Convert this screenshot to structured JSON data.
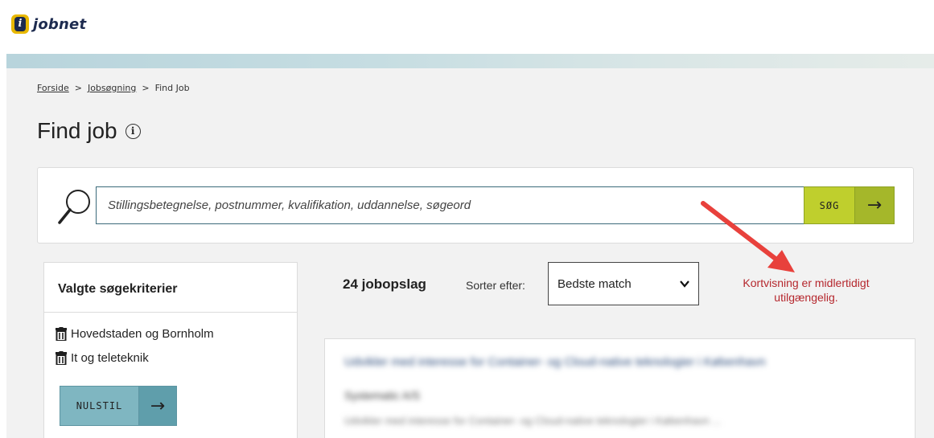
{
  "brand": {
    "name": "jobnet",
    "mark": "i"
  },
  "breadcrumb": {
    "items": [
      "Forside",
      "Jobsøgning",
      "Find Job"
    ],
    "separator": ">"
  },
  "page_title": "Find job",
  "search": {
    "placeholder": "Stillingsbetegnelse, postnummer, kvalifikation, uddannelse, søgeord",
    "button_label": "SØG",
    "button_arrow": "→"
  },
  "sidebar": {
    "heading": "Valgte søgekriterier",
    "criteria": [
      "Hovedstaden og Bornholm",
      "It og teleteknik"
    ],
    "reset_label": "NULSTIL",
    "reset_arrow": "→"
  },
  "results": {
    "count_text": "24 jobopslag",
    "sort_label": "Sorter efter:",
    "sort_value": "Bedste match",
    "notice": "Kortvisning er midlertidigt utilgængelig."
  },
  "job_preview": {
    "title": "Udvikler med interesse for Container- og Cloud-native teknologier i København",
    "company": "Systematic A/S",
    "snippet": "Udvikler med interesse for Container- og Cloud-native teknologier i København ..."
  },
  "colors": {
    "accent_green": "#bfcf2d",
    "teal_button": "#7fb6c1",
    "notice_red": "#b5272d",
    "annotation_arrow": "#e8413c"
  }
}
